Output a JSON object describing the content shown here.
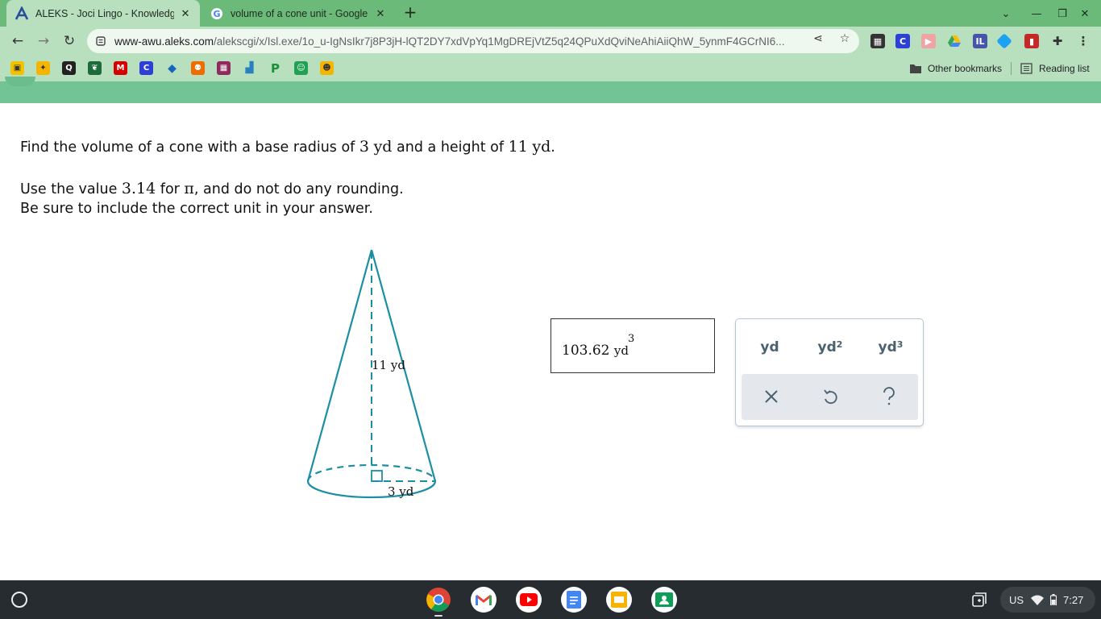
{
  "browser": {
    "tabs": [
      {
        "title": "ALEKS - Joci Lingo - Knowledge Check",
        "active": true,
        "favicon": "aleks-A-icon"
      },
      {
        "title": "volume of a cone unit - Google Search",
        "active": false,
        "favicon": "google-g-icon"
      }
    ],
    "address_bar": {
      "host": "www-awu.aleks.com",
      "path": "/alekscgi/x/Isl.exe/1o_u-IgNsIkr7j8P3jH-lQT2DY7xdVpYq1MgDREjVtZ5q24QPuXdQviNeAhiAiiQhW_5ynmF4GCrNI6..."
    },
    "bookmarks": {
      "other_label": "Other bookmarks",
      "reading_list_label": "Reading list"
    }
  },
  "problem": {
    "line1_prefix": "Find the volume of a cone with a base radius of ",
    "radius_value": "3",
    "radius_unit": "yd",
    "line1_mid": " and a height of ",
    "height_value": "11",
    "height_unit": "yd",
    "line1_suffix": ".",
    "line2_prefix": "Use the value ",
    "pi_value": "3.14",
    "line2_mid": " for ",
    "pi_symbol": "π",
    "line2_suffix": ", and do not do any rounding.",
    "line3": "Be sure to include the correct unit in your answer."
  },
  "diagram": {
    "height_label": "11 yd",
    "radius_label": "3 yd",
    "stroke_color": "#1c8ea3"
  },
  "answer": {
    "value": "103.62",
    "unit": "yd",
    "exponent": "3"
  },
  "keypad": {
    "unit_buttons": [
      {
        "base": "yd",
        "exp": ""
      },
      {
        "base": "yd",
        "exp": "2"
      },
      {
        "base": "yd",
        "exp": "3"
      }
    ]
  },
  "shelf": {
    "locale": "US",
    "time": "7:27"
  },
  "colors": {
    "tab_strip": "#6cba79",
    "toolbar": "#b9e0be",
    "page_band": "#72c396",
    "keypad_text": "#4a6170"
  }
}
